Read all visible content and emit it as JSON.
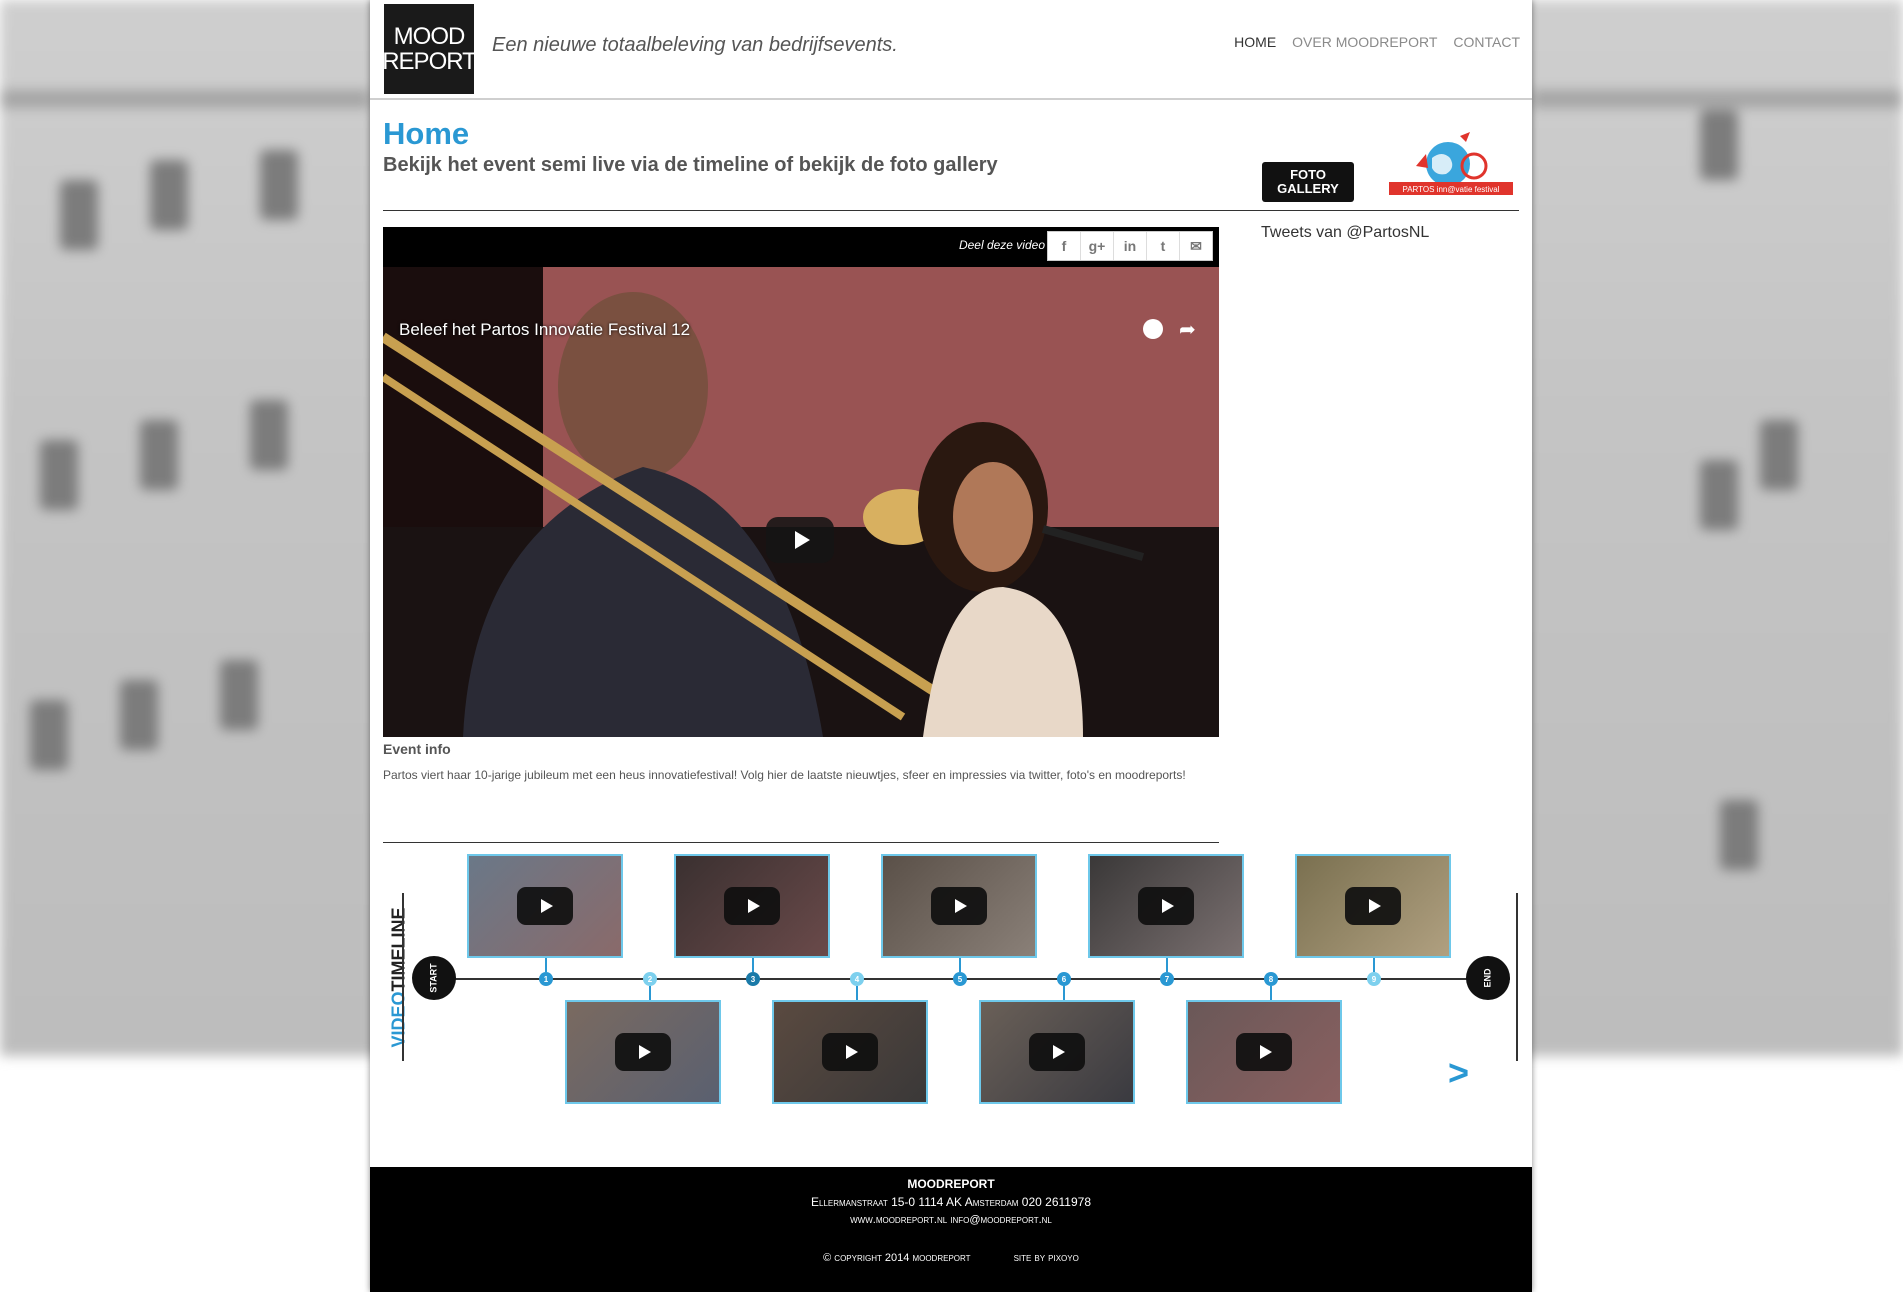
{
  "header": {
    "logo_line1": "MOOD",
    "logo_line2": "REPORT",
    "tagline": "Een nieuwe totaalbeleving van bedrijfsevents.",
    "nav": [
      {
        "label": "HOME",
        "active": true
      },
      {
        "label": "OVER MOODREPORT",
        "active": false
      },
      {
        "label": "CONTACT",
        "active": false
      }
    ]
  },
  "main": {
    "title": "Home",
    "subtitle": "Bekijk het event semi live via de timeline of bekijk de foto gallery",
    "foto_gallery_line1": "FOTO",
    "foto_gallery_line2": "GALLERY",
    "festival_logo_text": "PARTOS inn@vatie festival",
    "tweets_label": "Tweets van @PartosNL"
  },
  "video": {
    "share_label": "Deel deze video",
    "share_icons": [
      "facebook-icon",
      "google-plus-icon",
      "linkedin-icon",
      "twitter-icon",
      "mail-icon"
    ],
    "title": "Beleef het Partos Innovatie Festival 12"
  },
  "event_info": {
    "title": "Event info",
    "text": "Partos viert haar 10-jarige jubileum met een heus innovatiefestival! Volg hier de laatste nieuwtjes, sfeer en impressies via twitter, foto's en moodreports!"
  },
  "timeline": {
    "label_video": "VIDEO",
    "label_timeline": "TIMELINE",
    "start_label": "START",
    "end_label": "END",
    "markers": [
      "1",
      "2",
      "3",
      "4",
      "5",
      "6",
      "7",
      "8",
      "9"
    ],
    "next_label": ">"
  },
  "footer": {
    "name": "MOODREPORT",
    "address": "Ellermanstraat 15-0    1114 AK Amsterdam    020 2611978",
    "web": "www.moodreport.nl    info@moodreport.nl",
    "copyright": "© copyright 2014 moodreport",
    "site_by": "site by pixoyo"
  },
  "colors": {
    "accent": "#2a98d3",
    "timeline_light": "#6ec8ea",
    "footer_bg": "#000000"
  }
}
